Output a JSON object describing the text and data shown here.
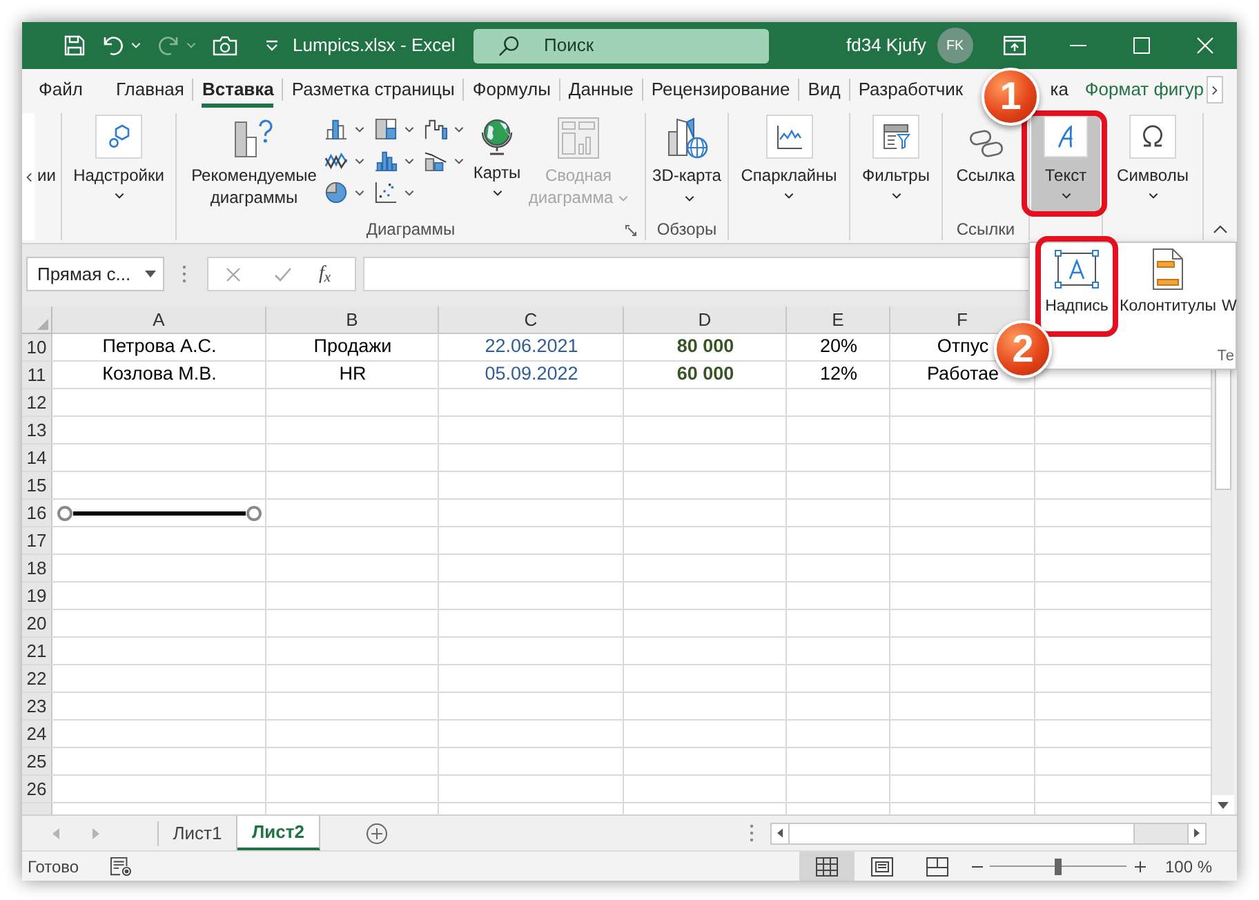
{
  "title_bar": {
    "quick_access": [
      {
        "kind": "save",
        "has_menu": false,
        "disabled": false
      },
      {
        "kind": "undo",
        "has_menu": true,
        "disabled": false
      },
      {
        "kind": "redo",
        "has_menu": true,
        "disabled": true
      },
      {
        "kind": "camera",
        "has_menu": false,
        "disabled": false
      },
      {
        "kind": "customize",
        "has_menu": false,
        "disabled": false
      }
    ],
    "title": "Lumpics.xlsx - Excel",
    "search": {
      "placeholder": "Поиск"
    },
    "user_name": "fd34 Kjufy",
    "user_initials": "FK"
  },
  "tabs": [
    {
      "label": "Файл",
      "selected": false,
      "contextual": false
    },
    {
      "label": "Главная",
      "selected": false,
      "contextual": false
    },
    {
      "label": "Вставка",
      "selected": true,
      "contextual": false
    },
    {
      "label": "Разметка страницы",
      "selected": false,
      "contextual": false
    },
    {
      "label": "Формулы",
      "selected": false,
      "contextual": false
    },
    {
      "label": "Данные",
      "selected": false,
      "contextual": false
    },
    {
      "label": "Рецензирование",
      "selected": false,
      "contextual": false
    },
    {
      "label": "Вид",
      "selected": false,
      "contextual": false
    },
    {
      "label": "Разработчик",
      "selected": false,
      "contextual": false
    },
    {
      "label": "ка",
      "selected": false,
      "contextual": false
    },
    {
      "label": "Формат фигур",
      "selected": false,
      "contextual": true
    }
  ],
  "ribbon": {
    "groups": [
      {
        "launcher": false,
        "buttons": [
          {
            "kind": "cut",
            "label": "ии"
          }
        ]
      },
      {
        "launcher": false,
        "buttons": [
          {
            "kind": "large",
            "label": "Надстройки",
            "has_menu": true,
            "pressed": false,
            "disabled": false
          }
        ]
      },
      {
        "label": "Диаграммы",
        "launcher": true,
        "buttons": [
          {
            "kind": "large",
            "label": "Рекомендуемые диаграммы",
            "has_menu": false,
            "pressed": false,
            "disabled": false
          },
          {
            "kind": "chart_grid",
            "items": [
              {
                "has_menu": true
              },
              {
                "has_menu": true
              },
              {
                "has_menu": true
              },
              {
                "has_menu": true
              },
              {
                "has_menu": true
              },
              {
                "has_menu": true
              },
              {
                "has_menu": true
              },
              {
                "has_menu": true
              }
            ]
          },
          {
            "kind": "large",
            "label": "Карты",
            "has_menu": true,
            "pressed": false,
            "disabled": false
          },
          {
            "kind": "large",
            "label": "Сводная диаграмма",
            "has_menu": true,
            "pressed": false,
            "disabled": true
          }
        ]
      },
      {
        "label": "Обзоры",
        "launcher": false,
        "buttons": [
          {
            "kind": "large",
            "label": "3D-карта",
            "has_menu": true,
            "pressed": false,
            "disabled": false
          }
        ]
      },
      {
        "launcher": false,
        "buttons": [
          {
            "kind": "large",
            "label": "Спарклайны",
            "has_menu": true,
            "pressed": false,
            "disabled": false
          }
        ]
      },
      {
        "launcher": false,
        "buttons": [
          {
            "kind": "large",
            "label": "Фильтры",
            "has_menu": true,
            "pressed": false,
            "disabled": false
          }
        ]
      },
      {
        "label": "Ссылки",
        "launcher": false,
        "buttons": [
          {
            "kind": "large",
            "label": "Ссылка",
            "has_menu": false,
            "pressed": false,
            "disabled": false
          }
        ]
      },
      {
        "launcher": false,
        "buttons": [
          {
            "kind": "large",
            "label": "Текст",
            "has_menu": true,
            "pressed": true,
            "disabled": false
          }
        ]
      },
      {
        "launcher": false,
        "buttons": [
          {
            "kind": "large",
            "label": "Символы",
            "has_menu": true,
            "pressed": false,
            "disabled": false
          }
        ]
      }
    ]
  },
  "formula_bar": {
    "name_box": "Прямая с...",
    "function_button": "f$_{x}$"
  },
  "sheet": {
    "columns": [
      {
        "label": "A",
        "kind": "text"
      },
      {
        "label": "B",
        "kind": "text"
      },
      {
        "label": "C",
        "kind": "date"
      },
      {
        "label": "D",
        "kind": "amount"
      },
      {
        "label": "E",
        "kind": "text"
      },
      {
        "label": "F",
        "kind": "text"
      }
    ],
    "rows": [
      {
        "number": "10",
        "cells": [
          "Петрова А.С.",
          "Продажи",
          "22.06.2021",
          "80 000",
          "20%",
          "Отпус"
        ]
      },
      {
        "number": "11",
        "cells": [
          "Козлова М.В.",
          "HR",
          "05.09.2022",
          "60 000",
          "12%",
          "Работае"
        ]
      },
      {
        "number": "12"
      },
      {
        "number": "13"
      },
      {
        "number": "14"
      },
      {
        "number": "15"
      },
      {
        "number": "16"
      },
      {
        "number": "17"
      },
      {
        "number": "18"
      },
      {
        "number": "19"
      },
      {
        "number": "20"
      },
      {
        "number": "21"
      },
      {
        "number": "22"
      },
      {
        "number": "23"
      },
      {
        "number": "24"
      },
      {
        "number": "25"
      },
      {
        "number": "26"
      }
    ],
    "shapes": [
      {
        "kind": "line",
        "selected": true
      }
    ]
  },
  "sheet_tabs": [
    {
      "label": "Лист1",
      "selected": false
    },
    {
      "label": "Лист2",
      "selected": true
    }
  ],
  "status_bar": {
    "status": "Готово",
    "views": [
      {
        "selected": true
      },
      {
        "selected": false
      },
      {
        "selected": false
      }
    ],
    "zoom": {
      "level": 0.5,
      "reading": "100 %"
    }
  },
  "text_gallery": {
    "items": [
      {
        "label": "Надпись"
      },
      {
        "label": "Колонтитулы"
      },
      {
        "label": "W"
      }
    ],
    "group_label": "Те"
  },
  "annotations": [
    {
      "number": "1"
    },
    {
      "number": "2"
    }
  ]
}
